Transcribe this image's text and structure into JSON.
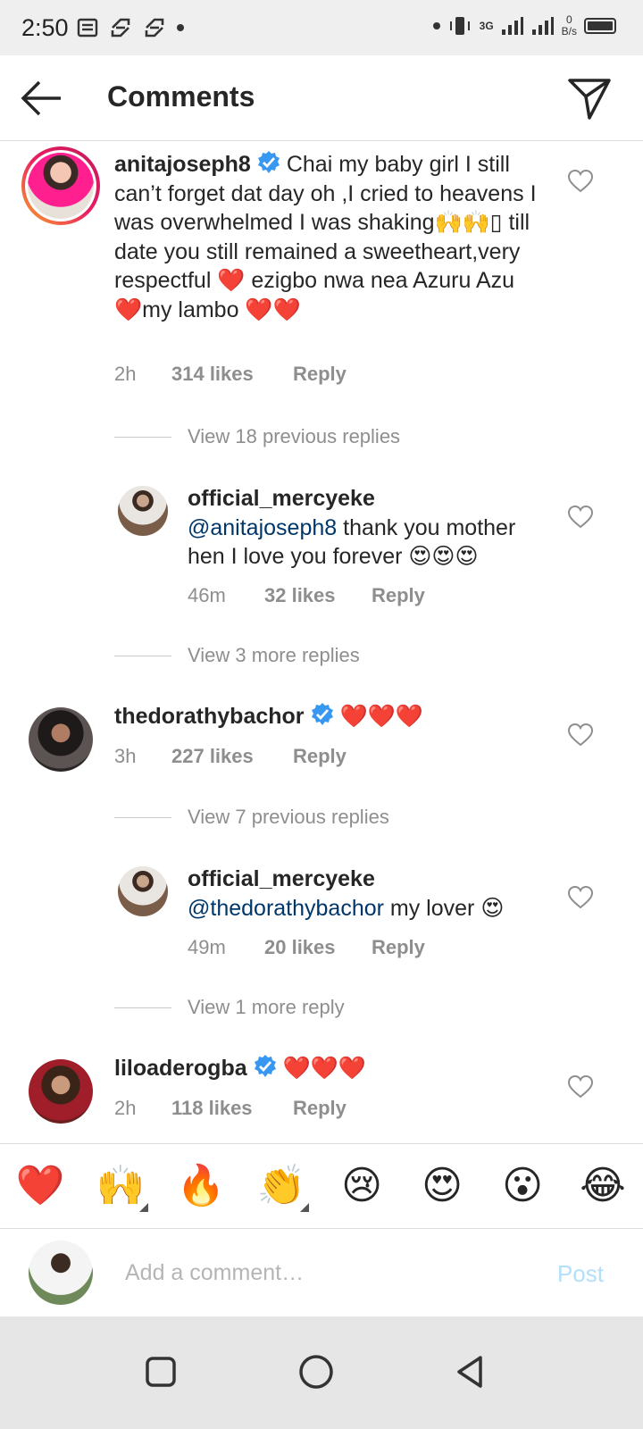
{
  "status_bar": {
    "time": "2:50",
    "network_type": "3G",
    "net_speed_value": "0",
    "net_speed_unit": "B/s"
  },
  "header": {
    "title": "Comments"
  },
  "comments": [
    {
      "username": "anitajoseph8",
      "verified": true,
      "text": "Chai my baby girl I still can’t forget dat day oh ,I cried to heavens I was overwhelmed I was shaking🙌🙌▯ till date you still remained a sweetheart,very respectful ❤️ ezigbo nwa nea Azuru Azu ❤️my lambo ❤️❤️",
      "time": "2h",
      "likes": "314 likes",
      "reply": "Reply",
      "view_replies": "View 18 previous replies",
      "reply_comment": {
        "username": "official_mercyeke",
        "mention": "@anitajoseph8",
        "text": " thank you mother hen I love you forever 😍😍😍",
        "time": "46m",
        "likes": "32 likes",
        "reply": "Reply"
      },
      "more_replies": "View 3 more replies"
    },
    {
      "username": "thedorathybachor",
      "verified": true,
      "text": "❤️❤️❤️",
      "time": "3h",
      "likes": "227 likes",
      "reply": "Reply",
      "view_replies": "View 7 previous replies",
      "reply_comment": {
        "username": "official_mercyeke",
        "mention": "@thedorathybachor",
        "text": " my lover 😍",
        "time": "49m",
        "likes": "20 likes",
        "reply": "Reply"
      },
      "more_replies": "View 1 more reply"
    },
    {
      "username": "liloaderogba",
      "verified": true,
      "text": "❤️❤️❤️",
      "time": "2h",
      "likes": "118 likes",
      "reply": "Reply"
    }
  ],
  "emoji_bar": [
    "❤️",
    "🙌",
    "🔥",
    "👏",
    "😢",
    "😍",
    "😮",
    "😂"
  ],
  "composer": {
    "placeholder": "Add a comment…",
    "post_label": "Post"
  },
  "colors": {
    "verified_blue": "#3897f0",
    "link_blue": "#00376b",
    "post_disabled": "#b2dffc",
    "secondary_text": "#8e8e8e"
  }
}
